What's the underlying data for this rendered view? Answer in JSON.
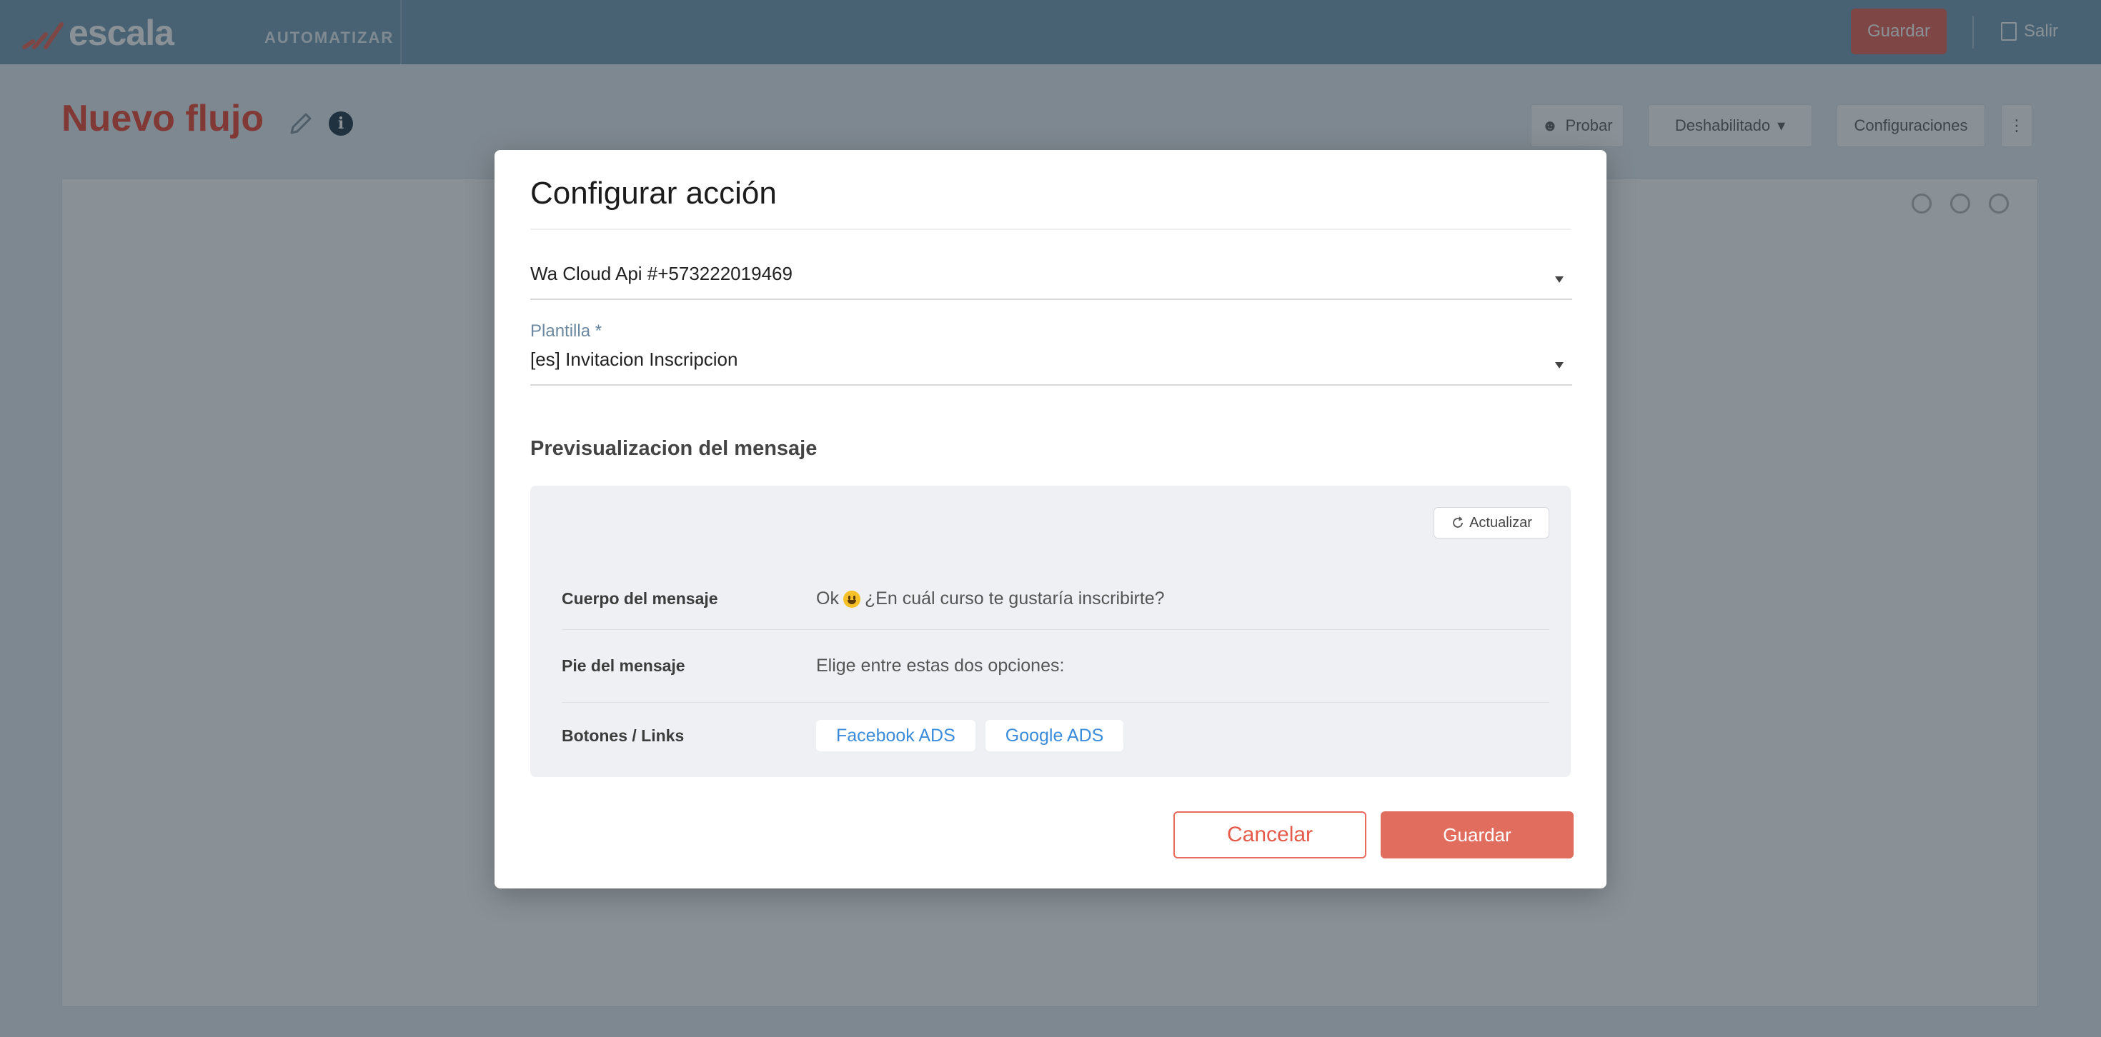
{
  "topbar": {
    "logo_text": "escala",
    "nav_link": "AUTOMATIZAR",
    "save_label": "Guardar",
    "logout_label": "Salir"
  },
  "page": {
    "title": "Nuevo flujo",
    "toolbar": {
      "test_label": "Probar",
      "status_label": "Deshabilitado",
      "config_label": "Configuraciones"
    }
  },
  "modal": {
    "title": "Configurar acción",
    "account_select": {
      "value": "Wa Cloud Api #+573222019469"
    },
    "template_select": {
      "label": "Plantilla *",
      "value": "[es] Invitacion Inscripcion"
    },
    "preview": {
      "title": "Previsualizacion del mensaje",
      "refresh_label": "Actualizar",
      "body": {
        "label": "Cuerpo del mensaje",
        "prefix": "Ok",
        "text": "¿En cuál curso te gustaría inscribirte?"
      },
      "footer": {
        "label": "Pie del mensaje",
        "text": "Elige entre estas dos opciones:"
      },
      "buttons": {
        "label": "Botones / Links",
        "items": [
          "Facebook ADS",
          "Google ADS"
        ]
      }
    },
    "cancel_label": "Cancelar",
    "save_label": "Guardar"
  },
  "colors": {
    "accent": "#e96b5c",
    "topbar": "#7da1b7",
    "link": "#3b8ddb",
    "title_red": "#ef4f3c"
  }
}
